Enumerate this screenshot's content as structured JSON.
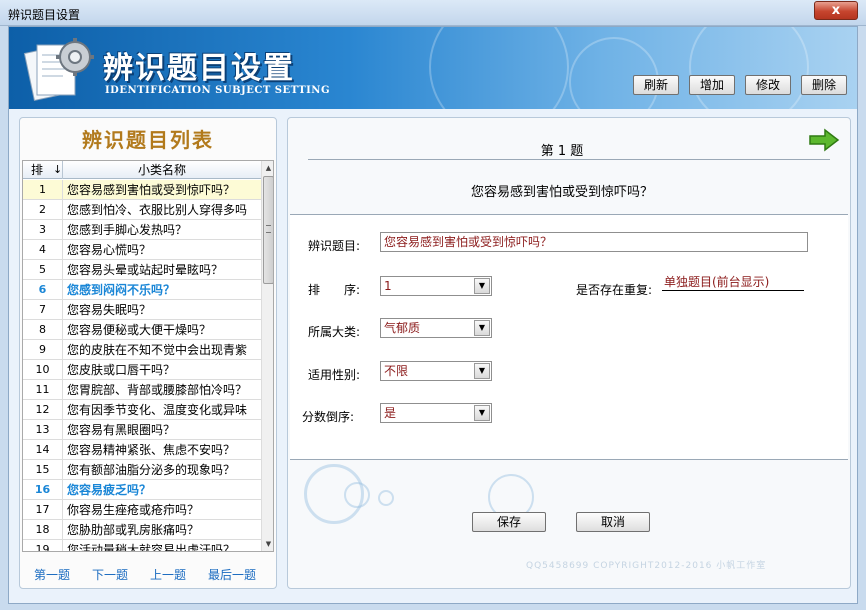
{
  "window": {
    "title": "辨识题目设置",
    "close": "x"
  },
  "banner": {
    "title": "辨识题目设置",
    "subtitle": "IDENTIFICATION SUBJECT SETTING"
  },
  "toolbar": {
    "refresh": "刷新",
    "add": "增加",
    "modify": "修改",
    "delete": "删除"
  },
  "list": {
    "title": "辨识题目列表",
    "col_order": "排",
    "sort_arrow": "↓",
    "col_name": "小类名称",
    "rows": [
      {
        "n": "1",
        "t": "您容易感到害怕或受到惊吓吗？"
      },
      {
        "n": "2",
        "t": "您感到怕冷、衣服比别人穿得多吗"
      },
      {
        "n": "3",
        "t": "您感到手脚心发热吗？"
      },
      {
        "n": "4",
        "t": "您容易心慌吗？"
      },
      {
        "n": "5",
        "t": "您容易头晕或站起时晕眩吗？"
      },
      {
        "n": "6",
        "t": "您感到闷闷不乐吗？"
      },
      {
        "n": "7",
        "t": "您容易失眠吗？"
      },
      {
        "n": "8",
        "t": "您容易便秘或大便干燥吗？"
      },
      {
        "n": "9",
        "t": "您的皮肤在不知不觉中会出现青紫"
      },
      {
        "n": "10",
        "t": "您皮肤或口唇干吗？"
      },
      {
        "n": "11",
        "t": "您胃脘部、背部或腰膝部怕冷吗？"
      },
      {
        "n": "12",
        "t": "您有因季节变化、温度变化或异味"
      },
      {
        "n": "13",
        "t": "您容易有黑眼圈吗？"
      },
      {
        "n": "14",
        "t": "您容易精神紧张、焦虑不安吗？"
      },
      {
        "n": "15",
        "t": "您有额部油脂分泌多的现象吗？"
      },
      {
        "n": "16",
        "t": "您容易疲乏吗？"
      },
      {
        "n": "17",
        "t": "你容易生痤疮或疮疖吗？"
      },
      {
        "n": "18",
        "t": "您胁肋部或乳房胀痛吗？"
      },
      {
        "n": "19",
        "t": "您活动量稍大就容易出虚汗吗？"
      }
    ],
    "nav": {
      "first": "第一题",
      "next": "下一题",
      "prev": "上一题",
      "last": "最后一题"
    }
  },
  "detail": {
    "index_label": "第 1 题",
    "question": "您容易感到害怕或受到惊吓吗？",
    "fields": {
      "title_label": "辨识题目:",
      "title_value": "您容易感到害怕或受到惊吓吗？",
      "order_label": "排　　序:",
      "order_value": "1",
      "duplicate_label": "是否存在重复:",
      "duplicate_value": "单独题目(前台显示)",
      "category_label": "所属大类:",
      "category_value": "气郁质",
      "gender_label": "适用性别:",
      "gender_value": "不限",
      "reverse_label": "分数倒序:",
      "reverse_value": "是"
    },
    "save": "保存",
    "cancel": "取消",
    "copyright": "QQ5458699 COPYRIGHT2012-2016 小帆工作室"
  },
  "icons": {
    "close": "close-icon",
    "dropdown": "chevron-down-icon",
    "next": "arrow-right-icon",
    "logo": "document-gear-icon"
  }
}
